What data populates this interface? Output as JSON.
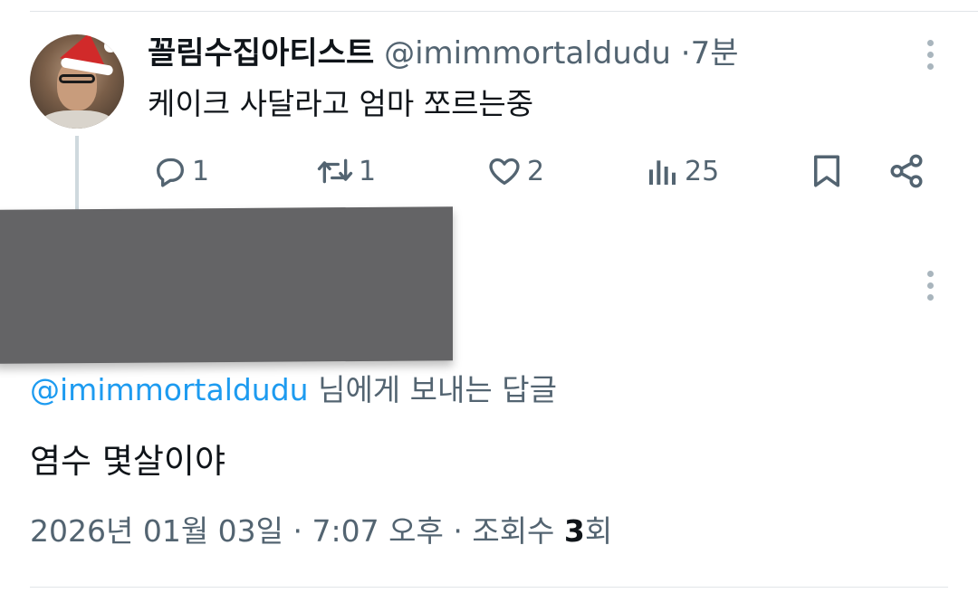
{
  "tweet": {
    "display_name": "꼴림수집아티스트",
    "handle": "@imimmortaldudu",
    "separator": "·",
    "time": "7분",
    "text": "케이크 사달라고 엄마 쪼르는중",
    "actions": {
      "reply_icon": "reply-icon",
      "reply_count": "1",
      "retweet_icon": "retweet-icon",
      "retweet_count": "1",
      "like_icon": "heart-icon",
      "like_count": "2",
      "views_icon": "views-bar-chart-icon",
      "views_count": "25",
      "bookmark_icon": "bookmark-icon",
      "share_icon": "share-icon"
    }
  },
  "reply": {
    "mention": "@imimmortaldudu",
    "reply_suffix": " 님에게 보내는 답글",
    "text": "염수 몇살이야",
    "date": "2026년 01월 03일",
    "separator1": " · ",
    "clock": "7:07 오후",
    "separator2": " · ",
    "views_label": "조회수 ",
    "views_count": "3",
    "views_unit": "회"
  },
  "colors": {
    "accent": "#1d9bf0",
    "secondary_text": "#536471",
    "primary_text": "#0f1419",
    "redaction": "#646466"
  }
}
